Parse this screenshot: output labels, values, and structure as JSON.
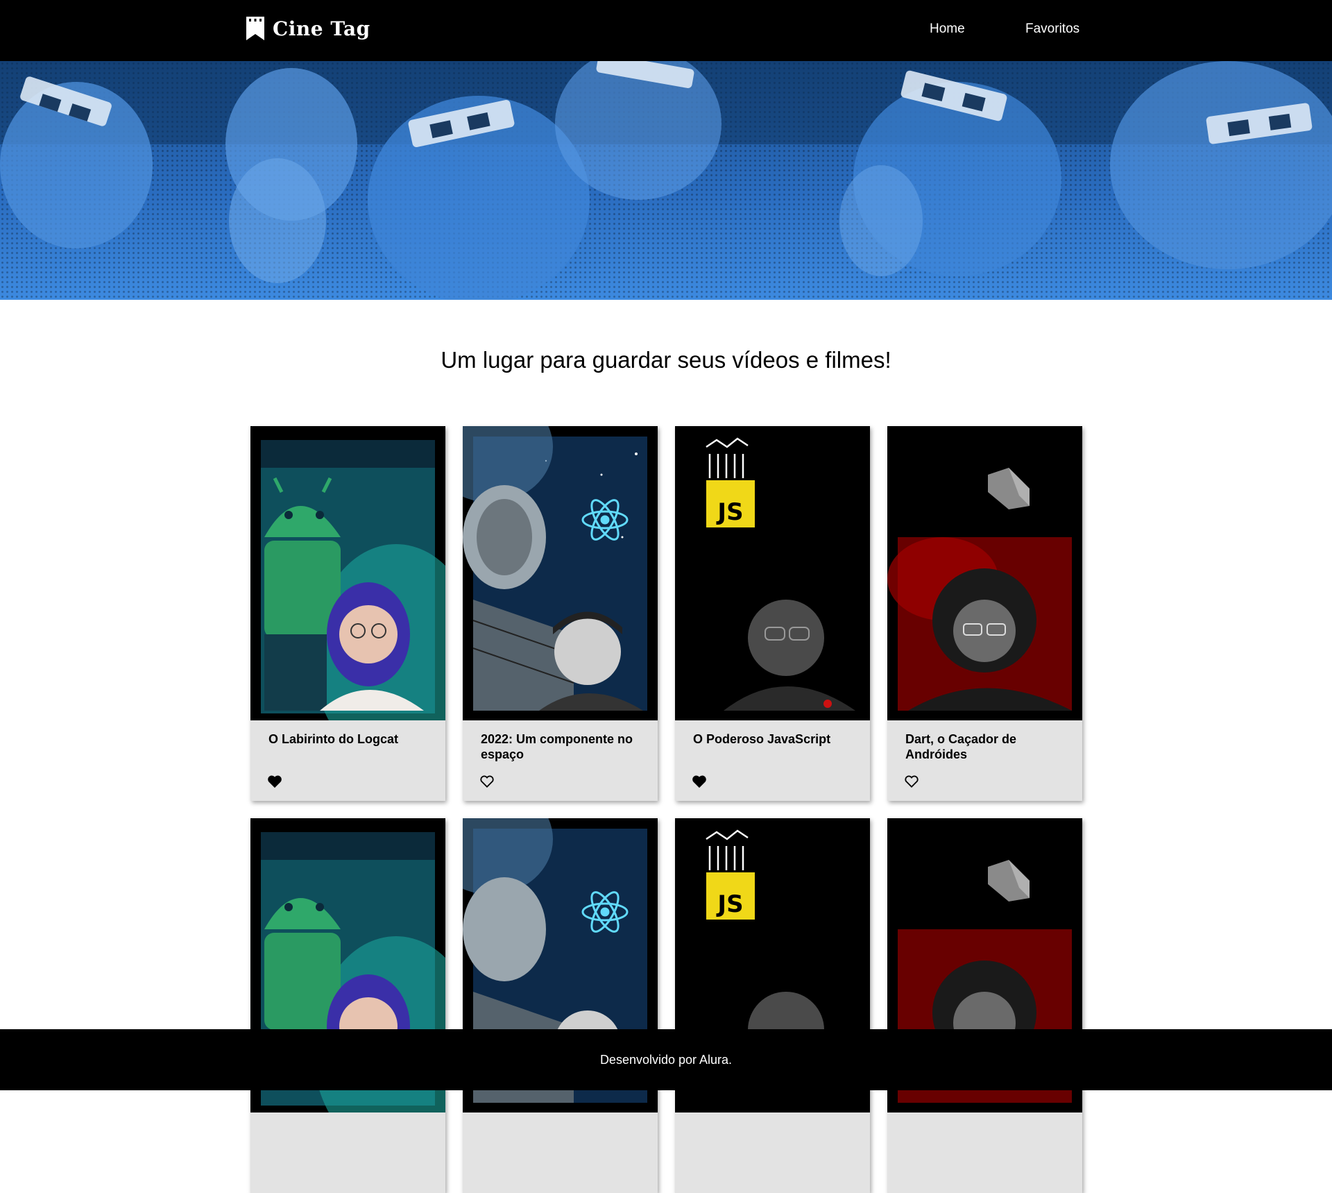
{
  "header": {
    "logo_text": "Cine Tag",
    "nav": [
      {
        "label": "Home"
      },
      {
        "label": "Favoritos"
      }
    ]
  },
  "main": {
    "title": "Um lugar para guardar seus vídeos e filmes!",
    "cards": [
      {
        "title": "O Labirinto do Logcat",
        "favorited": true,
        "thumbnail": "android-theme"
      },
      {
        "title": "2022: Um componente no espaço",
        "favorited": false,
        "thumbnail": "react-space-theme"
      },
      {
        "title": "O Poderoso JavaScript",
        "favorited": true,
        "thumbnail": "javascript-theme"
      },
      {
        "title": "Dart, o Caçador de Andróides",
        "favorited": false,
        "thumbnail": "dart-theme"
      },
      {
        "title": "",
        "favorited": false,
        "thumbnail": "android-theme"
      },
      {
        "title": "",
        "favorited": false,
        "thumbnail": "react-space-theme"
      },
      {
        "title": "",
        "favorited": false,
        "thumbnail": "javascript-theme"
      },
      {
        "title": "",
        "favorited": false,
        "thumbnail": "dart-theme"
      }
    ]
  },
  "footer": {
    "text": "Desenvolvido por Alura."
  },
  "colors": {
    "header_bg": "#000000",
    "banner_blue": "#2a6cbf",
    "card_bg": "#e3e3e3",
    "js_yellow": "#f0d818",
    "react_cyan": "#61dafb",
    "android_green": "#2fa86a",
    "dart_red": "#a00000"
  }
}
